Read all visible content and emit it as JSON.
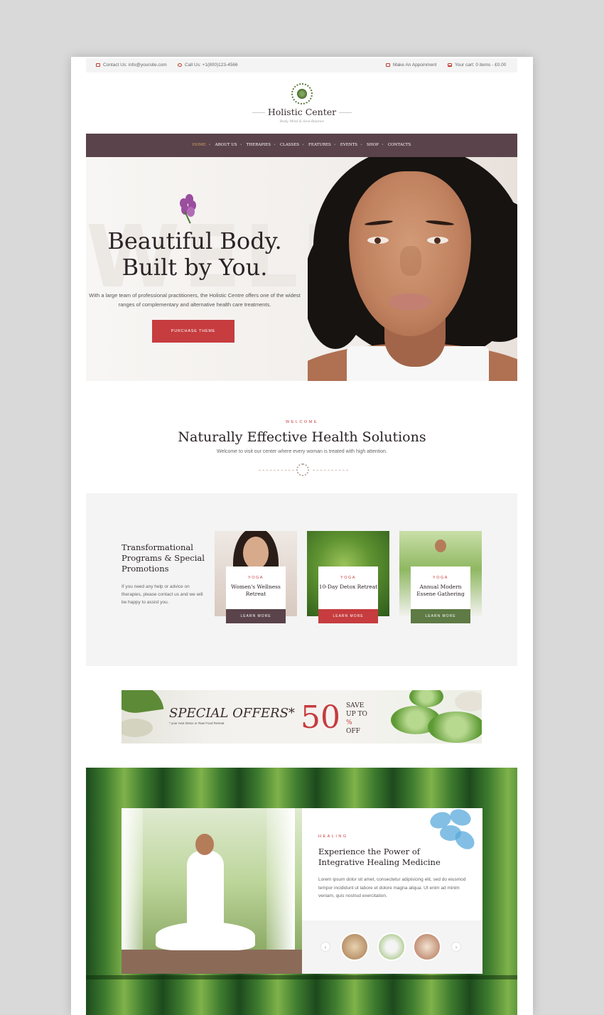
{
  "topbar": {
    "contact": "Contact Us: info@yoursite.com",
    "call": "Call Us: +1(800)123-4566",
    "appointment": "Make An Appoinment",
    "cart": "Your cart: 0 items - £0.00"
  },
  "logo": {
    "name": "Holistic Center",
    "tagline": "Body, Mind & Soul Balance"
  },
  "nav": {
    "items": [
      "HOME",
      "ABOUT US",
      "THERAPIES",
      "CLASSES",
      "FEATURES",
      "EVENTS",
      "SHOP",
      "CONTACTS"
    ]
  },
  "hero": {
    "bg_word": "WELLNESS",
    "title_line1": "Beautiful Body.",
    "title_line2": "Built by You.",
    "text_line1": "With a large team of professional practitioners, the Holistic Centre offers one of the widest",
    "text_line2": "ranges of complementary and alternative health care treatments.",
    "button": "PURCHASE THEME"
  },
  "welcome": {
    "kicker": "WELCOME",
    "title": "Naturally Effective Health Solutions",
    "subtitle": "Welcome to visit our center where every woman is treated with high attention."
  },
  "programs": {
    "title": "Transformational Programs & Special Promotions",
    "text_line1": "If you need any help or advice on",
    "text_line2": "therapies, please contact us and we will",
    "text_line3": "be happy to assist you.",
    "cards": [
      {
        "category": "YOGA",
        "title": "Women's Wellness Retreat",
        "button": "LEARN MORE",
        "color": "#5a434a"
      },
      {
        "category": "YOGA",
        "title": "10-Day Detox Retreat",
        "button": "LEARN MORE",
        "color": "#c63c3f"
      },
      {
        "category": "YOGA",
        "title": "Annual Modern Essene Gathering",
        "button": "LEARN MORE",
        "color": "#5e7a45"
      }
    ]
  },
  "offers": {
    "title": "SPECIAL OFFERS*",
    "note": "* your next Detox or Raw Food Retreat",
    "percent": "50",
    "save": "SAVE",
    "up_to": "UP TO",
    "pct_sign": "%",
    "off": "OFF"
  },
  "healing": {
    "category": "HEALING",
    "title": "Experience the Power of Integrative Healing Medicine",
    "text": "Lorem ipsum dolor sit amet, consectetur adipisicing elit, sed do eiusmod tempor incididunt ut labore et dolore magna aliqua. Ut enim ad minim veniam, quis nostrud exercitation."
  },
  "colors": {
    "accent": "#c63c3f",
    "nav": "#5a434a",
    "green": "#5e7a45"
  }
}
